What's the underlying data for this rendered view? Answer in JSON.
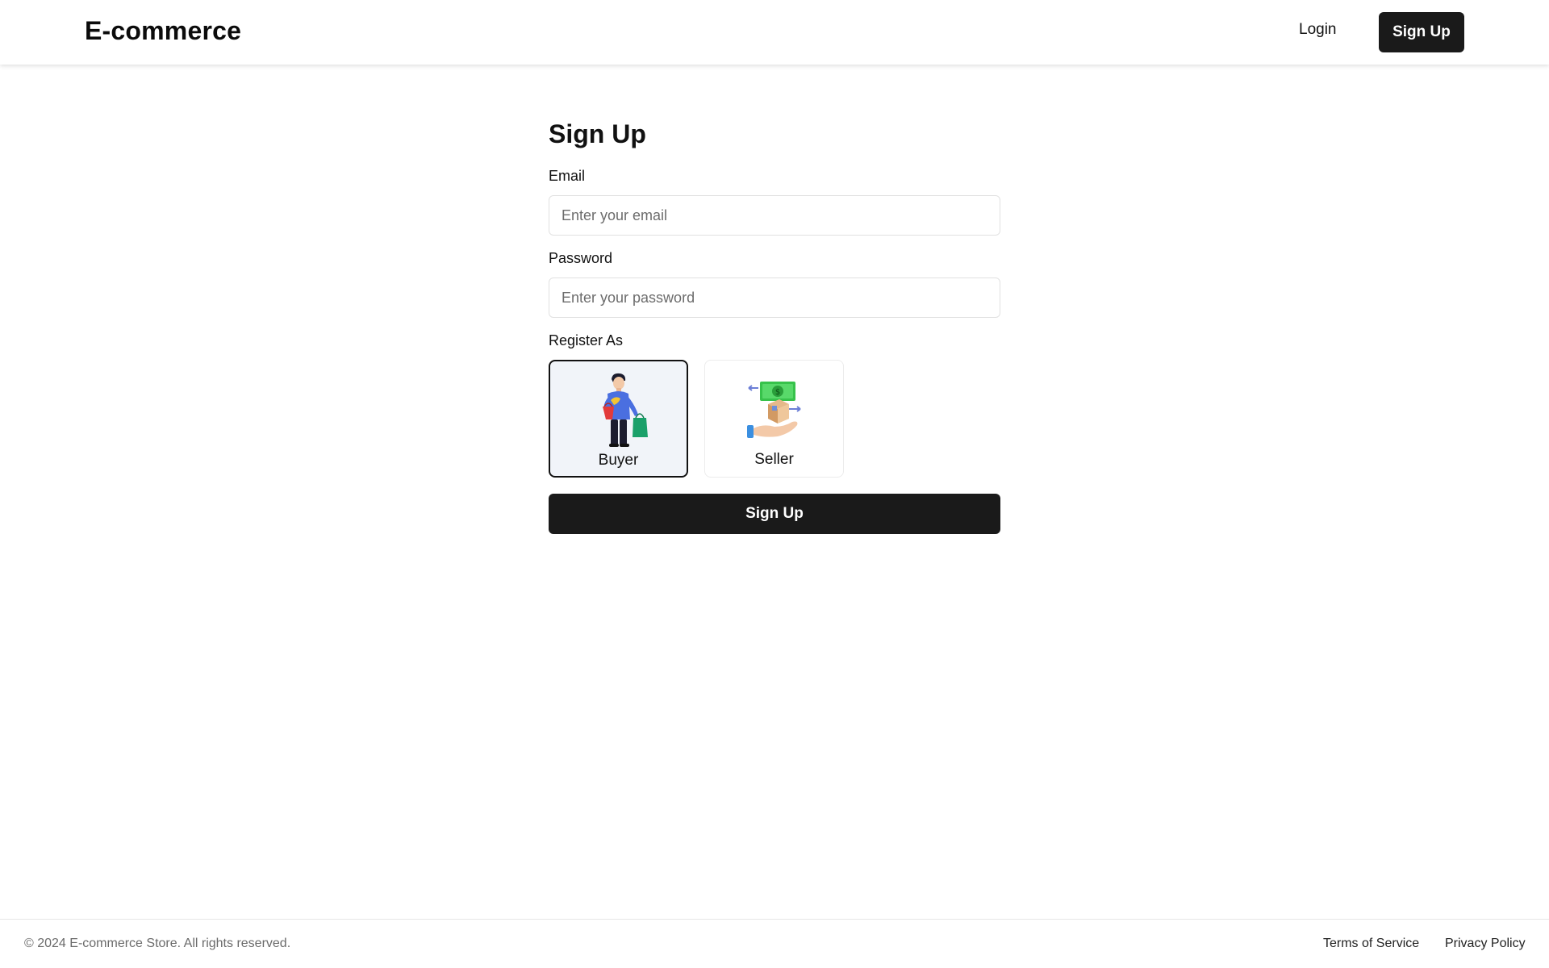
{
  "header": {
    "brand": "E-commerce",
    "login_label": "Login",
    "signup_label": "Sign Up"
  },
  "form": {
    "title": "Sign Up",
    "email": {
      "label": "Email",
      "placeholder": "Enter your email",
      "value": ""
    },
    "password": {
      "label": "Password",
      "placeholder": "Enter your password",
      "value": ""
    },
    "register_as_label": "Register As",
    "roles": [
      {
        "label": "Buyer",
        "selected": true,
        "icon": "buyer-illustration"
      },
      {
        "label": "Seller",
        "selected": false,
        "icon": "seller-illustration"
      }
    ],
    "submit_label": "Sign Up"
  },
  "footer": {
    "copyright": "© 2024 E-commerce Store. All rights reserved.",
    "terms_label": "Terms of Service",
    "privacy_label": "Privacy Policy"
  },
  "colors": {
    "primary_button": "#1a1a1a",
    "selected_role_bg": "#f1f4f9",
    "input_border": "#e1e1e1"
  }
}
